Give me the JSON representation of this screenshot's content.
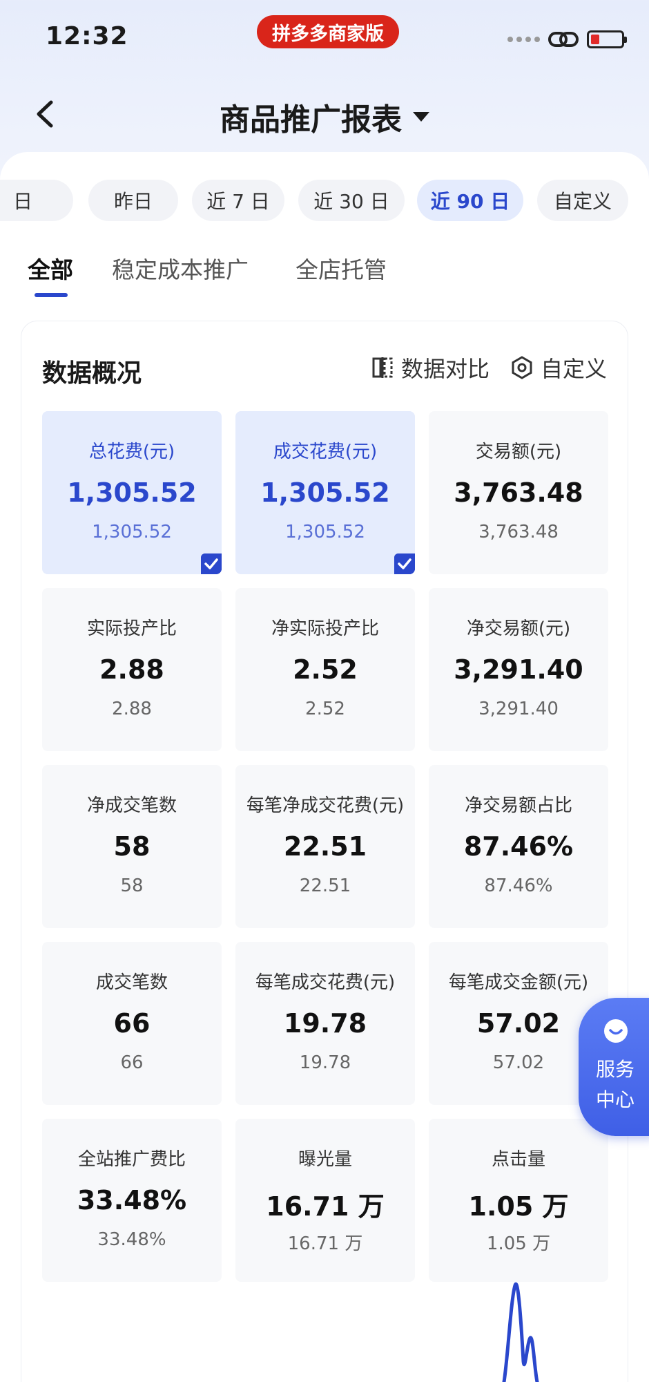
{
  "status_bar": {
    "time": "12:32",
    "app_badge": "拼多多商家版"
  },
  "header": {
    "title": "商品推广报表"
  },
  "date_chips": [
    {
      "label": "日",
      "active": false
    },
    {
      "label": "昨日",
      "active": false
    },
    {
      "label": "近 7 日",
      "active": false
    },
    {
      "label": "近 30 日",
      "active": false
    },
    {
      "label": "近 90 日",
      "active": true
    },
    {
      "label": "自定义",
      "active": false
    }
  ],
  "tabs": [
    {
      "label": "全部",
      "active": true
    },
    {
      "label": "稳定成本推广",
      "active": false
    },
    {
      "label": "全店托管",
      "active": false
    }
  ],
  "overview": {
    "title": "数据概况",
    "compare_label": "数据对比",
    "customize_label": "自定义",
    "metrics": [
      {
        "label": "总花费(元)",
        "value": "1,305.52",
        "compare": "1,305.52",
        "selected": true
      },
      {
        "label": "成交花费(元)",
        "value": "1,305.52",
        "compare": "1,305.52",
        "selected": true
      },
      {
        "label": "交易额(元)",
        "value": "3,763.48",
        "compare": "3,763.48",
        "selected": false
      },
      {
        "label": "实际投产比",
        "value": "2.88",
        "compare": "2.88",
        "selected": false
      },
      {
        "label": "净实际投产比",
        "value": "2.52",
        "compare": "2.52",
        "selected": false
      },
      {
        "label": "净交易额(元)",
        "value": "3,291.40",
        "compare": "3,291.40",
        "selected": false
      },
      {
        "label": "净成交笔数",
        "value": "58",
        "compare": "58",
        "selected": false
      },
      {
        "label": "每笔净成交花费(元)",
        "value": "22.51",
        "compare": "22.51",
        "selected": false
      },
      {
        "label": "净交易额占比",
        "value": "87.46%",
        "compare": "87.46%",
        "selected": false
      },
      {
        "label": "成交笔数",
        "value": "66",
        "compare": "66",
        "selected": false
      },
      {
        "label": "每笔成交花费(元)",
        "value": "19.78",
        "compare": "19.78",
        "selected": false
      },
      {
        "label": "每笔成交金额(元)",
        "value": "57.02",
        "compare": "57.02",
        "selected": false
      },
      {
        "label": "全站推广费比",
        "value": "33.48%",
        "compare": "33.48%",
        "selected": false
      },
      {
        "label": "曝光量",
        "value": "16.71 万",
        "compare": "16.71 万",
        "selected": false
      },
      {
        "label": "点击量",
        "value": "1.05 万",
        "compare": "1.05 万",
        "selected": false
      }
    ]
  },
  "service_fab": {
    "label_line1": "服务",
    "label_line2": "中心"
  },
  "colors": {
    "accent": "#2a47cc",
    "badge_red": "#d9251a",
    "selected_card_bg": "#e5ecfd"
  }
}
